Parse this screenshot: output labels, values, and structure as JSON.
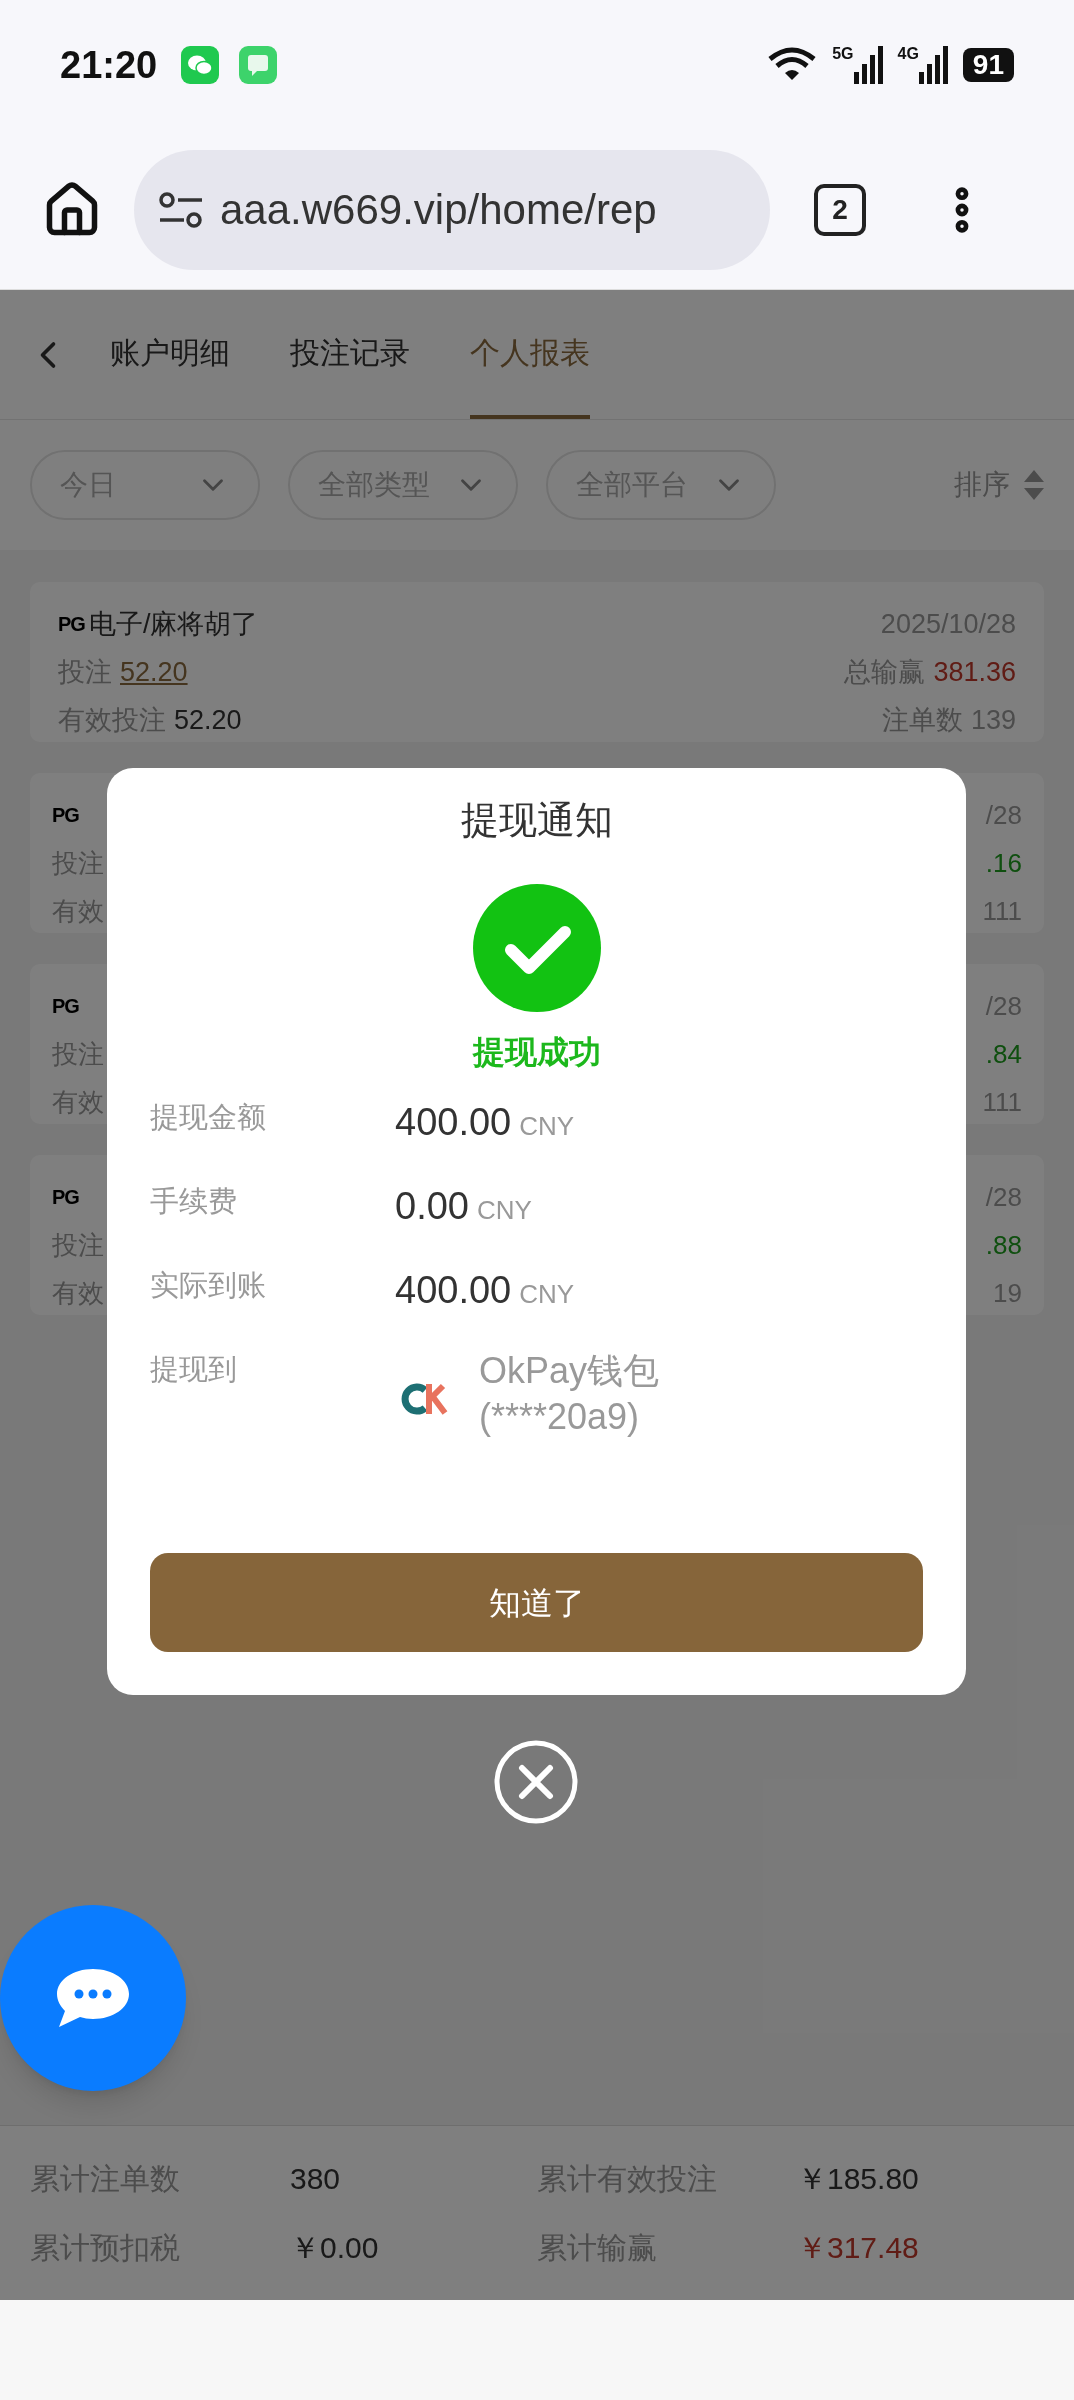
{
  "status_bar": {
    "time": "21:20",
    "network_1": "5G",
    "network_2": "4G",
    "battery": "91"
  },
  "browser": {
    "url": "aaa.w669.vip/home/rep",
    "tab_count": "2"
  },
  "tabs": [
    {
      "label": "账户明细",
      "selected": false
    },
    {
      "label": "投注记录",
      "selected": false
    },
    {
      "label": "个人报表",
      "selected": true
    }
  ],
  "filters": [
    {
      "label": "今日"
    },
    {
      "label": "全部类型"
    },
    {
      "label": "全部平台"
    }
  ],
  "sort": {
    "label": "排序"
  },
  "records": [
    {
      "kind": "full",
      "provider": "PG",
      "title": "电子/麻将胡了",
      "date": "2025/10/28",
      "bet_label": "投注",
      "bet": "52.20",
      "valid_label": "有效投注",
      "valid": "52.20",
      "total_label": "总输赢",
      "total": "381.36",
      "winning": true,
      "count_label": "注单数",
      "count": "139"
    },
    {
      "kind": "partial",
      "provider": "PG",
      "bet_label": "投注",
      "valid_label": "有效",
      "date": "/28",
      "total": ".16",
      "winning": false,
      "count": "111"
    },
    {
      "kind": "partial",
      "provider": "PG",
      "bet_label": "投注",
      "valid_label": "有效",
      "date": "/28",
      "total": ".84",
      "winning": false,
      "count": "111"
    },
    {
      "kind": "partial",
      "provider": "PG",
      "bet_label": "投注",
      "valid_label": "有效",
      "date": "/28",
      "total": ".88",
      "winning": false,
      "count": "19"
    }
  ],
  "summary": [
    {
      "label": "累计注单数",
      "value": "380",
      "highlighted": false
    },
    {
      "label": "累计有效投注",
      "value": "￥185.80",
      "highlighted": false
    },
    {
      "label": "累计预扣税",
      "value": "￥0.00",
      "highlighted": false
    },
    {
      "label": "累计输赢",
      "value": "￥317.48",
      "highlighted": true
    }
  ],
  "dialog": {
    "title": "提现通知",
    "status": "提现成功",
    "rows": [
      {
        "kind": "amount",
        "label": "提现金额",
        "value": "400.00",
        "unit": "CNY"
      },
      {
        "kind": "amount",
        "label": "手续费",
        "value": "0.00",
        "unit": "CNY"
      },
      {
        "kind": "amount",
        "label": "实际到账",
        "value": "400.00",
        "unit": "CNY"
      },
      {
        "kind": "wallet",
        "label": "提现到",
        "wallet": "OkPay钱包",
        "account": "(****20a9)"
      }
    ],
    "button": "知道了"
  }
}
